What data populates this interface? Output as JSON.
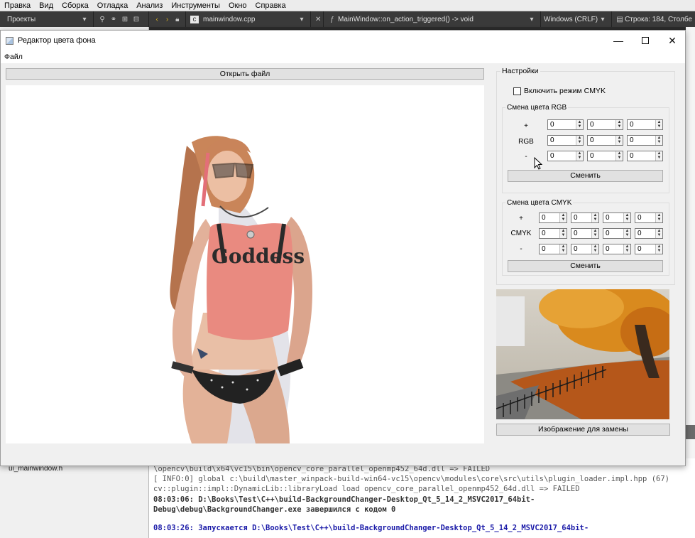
{
  "ide": {
    "menu": [
      "Правка",
      "Вид",
      "Сборка",
      "Отладка",
      "Анализ",
      "Инструменты",
      "Окно",
      "Справка"
    ],
    "projects_label": "Проекты",
    "file_tab": "mainwindow.cpp",
    "function_signature": "MainWindow::on_action_triggered() -> void",
    "line_ending": "Windows (CRLF)",
    "cursor_position": "Строка: 184, Столбе",
    "tree_item": "ui_mainwindow.h",
    "output_lines": [
      "\\opencv\\build\\x64\\vc15\\bin\\opencv_core_parallel_openmp452_64d.dll => FAILED",
      "[ INFO:0] global c:\\build\\master_winpack-build-win64-vc15\\opencv\\modules\\core\\src\\utils\\plugin_loader.impl.hpp (67)",
      "cv::plugin::impl::DynamicLib::libraryLoad load opencv_core_parallel_openmp452_64d.dll => FAILED",
      "08:03:06: D:\\Books\\Test\\C++\\build-BackgroundChanger-Desktop_Qt_5_14_2_MSVC2017_64bit-",
      "Debug\\debug\\BackgroundChanger.exe завершился с кодом 0",
      "08:03:26: Запускается D:\\Books\\Test\\C++\\build-BackgroundChanger-Desktop_Qt_5_14_2_MSVC2017_64bit-"
    ]
  },
  "app": {
    "title": "Редактор цвета фона",
    "menu_file": "Файл",
    "open_file_button": "Открыть файл",
    "main_image_text": "Goddess",
    "settings": {
      "title": "Настройки",
      "cmyk_toggle_label": "Включить режим CMYK",
      "cmyk_toggle_checked": false,
      "rgb_group": {
        "title": "Смена цвета RGB",
        "rows": [
          {
            "label": "+",
            "values": [
              "0",
              "0",
              "0"
            ]
          },
          {
            "label": "RGB",
            "values": [
              "0",
              "0",
              "0"
            ]
          },
          {
            "label": "-",
            "values": [
              "0",
              "0",
              "0"
            ]
          }
        ],
        "button": "Сменить"
      },
      "cmyk_group": {
        "title": "Смена цвета CMYK",
        "rows": [
          {
            "label": "+",
            "values": [
              "0",
              "0",
              "0",
              "0"
            ]
          },
          {
            "label": "CMYK",
            "values": [
              "0",
              "0",
              "0",
              "0"
            ]
          },
          {
            "label": "-",
            "values": [
              "0",
              "0",
              "0",
              "0"
            ]
          }
        ],
        "button": "Сменить"
      }
    },
    "replace_image_button": "Изображение для замены"
  }
}
